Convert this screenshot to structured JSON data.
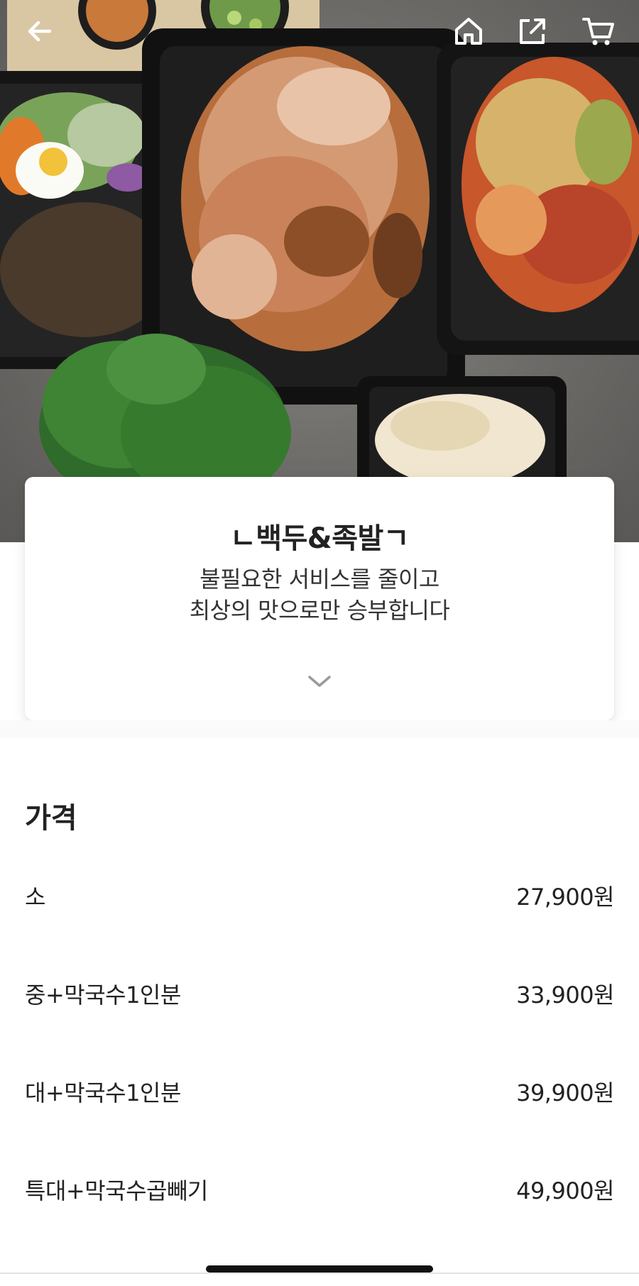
{
  "nav": {
    "back_icon": "arrow-left-icon",
    "home_icon": "home-icon",
    "share_icon": "share-icon",
    "cart_icon": "cart-icon",
    "icon_color": "#ffffff"
  },
  "hero": {
    "description_icon": "food-photo",
    "background_color": "#6d6b68"
  },
  "store": {
    "name": "ㄴ백두&족발ㄱ",
    "description_line1": "불필요한 서비스를 줄이고",
    "description_line2": "최상의 맛으로만 승부합니다",
    "expand_icon": "chevron-down-icon"
  },
  "price": {
    "title": "가격",
    "items": [
      {
        "label": "소",
        "price": "27,900원"
      },
      {
        "label": "중+막국수1인분",
        "price": "33,900원"
      },
      {
        "label": "대+막국수1인분",
        "price": "39,900원"
      },
      {
        "label": "특대+막국수곱빼기",
        "price": "49,900원"
      }
    ]
  }
}
